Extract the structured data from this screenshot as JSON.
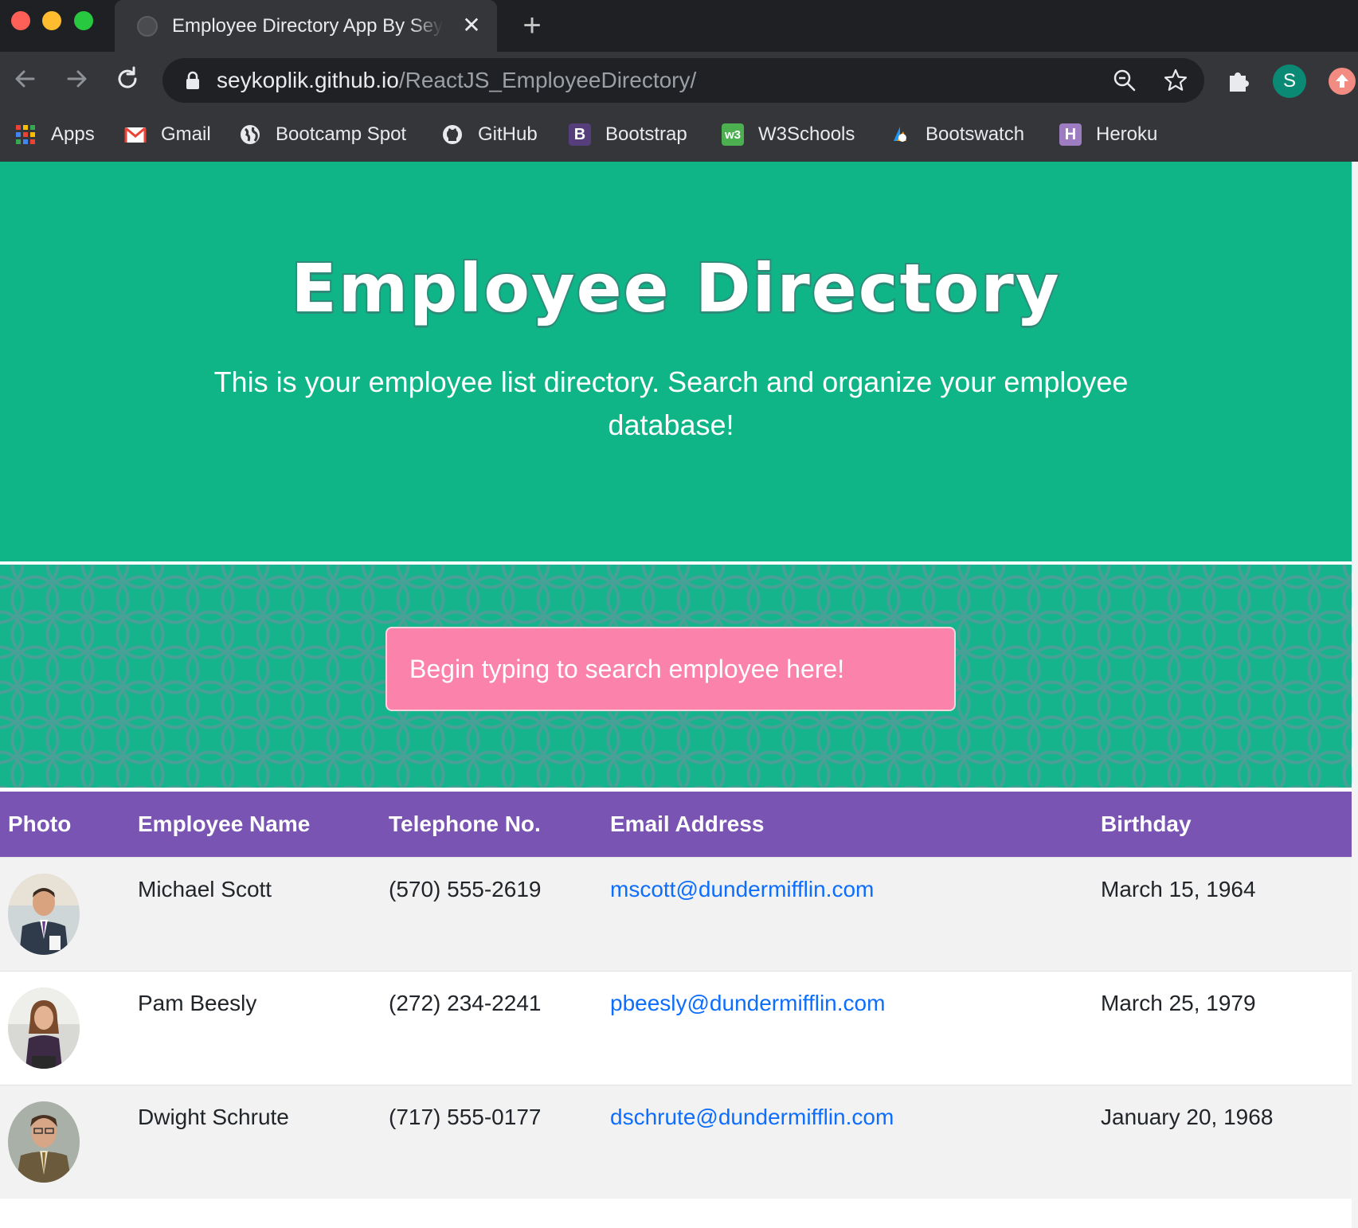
{
  "browser": {
    "tab_title": "Employee Directory App By Seykoplik",
    "url_host": "seykoplik.github.io",
    "url_path": "/ReactJS_EmployeeDirectory/",
    "profile_initial": "S"
  },
  "bookmarks": [
    {
      "label": "Apps",
      "icon": "apps-grid-icon"
    },
    {
      "label": "Gmail",
      "icon": "gmail-icon"
    },
    {
      "label": "Bootcamp Spot",
      "icon": "globe-icon"
    },
    {
      "label": "GitHub",
      "icon": "github-icon"
    },
    {
      "label": "Bootstrap",
      "icon": "bootstrap-icon"
    },
    {
      "label": "W3Schools",
      "icon": "w3schools-icon"
    },
    {
      "label": "Bootswatch",
      "icon": "bootswatch-icon"
    },
    {
      "label": "Heroku",
      "icon": "heroku-icon"
    }
  ],
  "hero": {
    "title": "Employee Directory",
    "subtitle": "This is your employee list directory. Search and organize your employee database!"
  },
  "search": {
    "placeholder": "Begin typing to search employee here!"
  },
  "table": {
    "headers": {
      "photo": "Photo",
      "name": "Employee Name",
      "telephone": "Telephone No.",
      "email": "Email Address",
      "birthday": "Birthday"
    },
    "rows": [
      {
        "name": "Michael Scott",
        "telephone": "(570) 555-2619",
        "email": "mscott@dundermifflin.com",
        "birthday": "March 15, 1964"
      },
      {
        "name": "Pam Beesly",
        "telephone": "(272) 234-2241",
        "email": "pbeesly@dundermifflin.com",
        "birthday": "March 25, 1979"
      },
      {
        "name": "Dwight Schrute",
        "telephone": "(717) 555-0177",
        "email": "dschrute@dundermifflin.com",
        "birthday": "January 20, 1968"
      }
    ]
  },
  "colors": {
    "hero_bg": "#10b587",
    "table_header_bg": "#7954b3",
    "search_bg": "#fb82aa",
    "link": "#0d6efd"
  }
}
